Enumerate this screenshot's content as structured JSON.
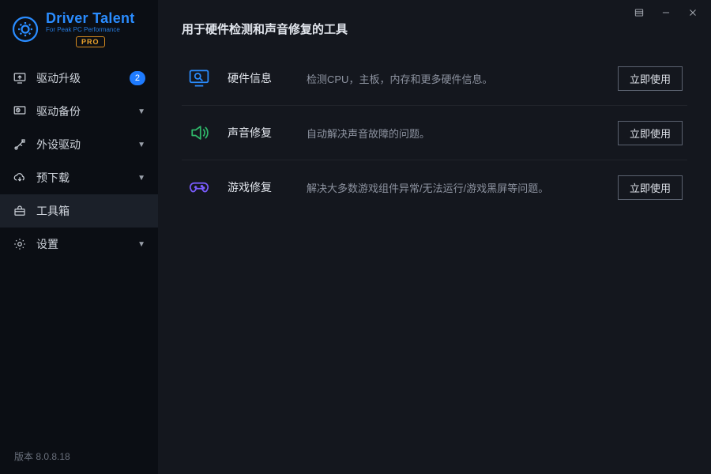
{
  "logo": {
    "title": "Driver Talent",
    "subtitle": "For Peak PC Performance",
    "pro": "PRO"
  },
  "sidebar": {
    "items": [
      {
        "label": "驱动升级",
        "badge": "2",
        "chevron": false
      },
      {
        "label": "驱动备份",
        "badge": null,
        "chevron": true
      },
      {
        "label": "外设驱动",
        "badge": null,
        "chevron": true
      },
      {
        "label": "预下载",
        "badge": null,
        "chevron": true
      },
      {
        "label": "工具箱",
        "badge": null,
        "chevron": false
      },
      {
        "label": "设置",
        "badge": null,
        "chevron": true
      }
    ]
  },
  "version_label": "版本 8.0.8.18",
  "main": {
    "title": "用于硬件检测和声音修复的工具",
    "tools": [
      {
        "name": "硬件信息",
        "desc": "检测CPU，主板，内存和更多硬件信息。",
        "action": "立即使用"
      },
      {
        "name": "声音修复",
        "desc": "自动解决声音故障的问题。",
        "action": "立即使用"
      },
      {
        "name": "游戏修复",
        "desc": "解决大多数游戏组件异常/无法运行/游戏黑屏等问题。",
        "action": "立即使用"
      }
    ]
  }
}
